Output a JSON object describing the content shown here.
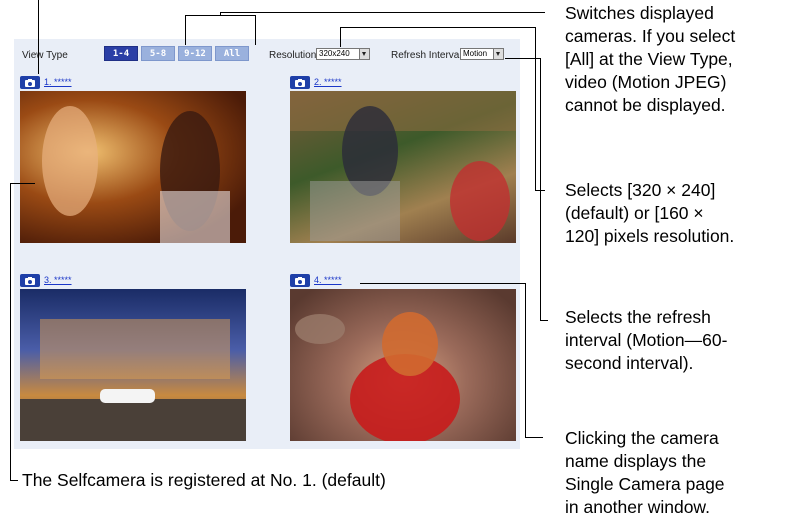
{
  "toolbar": {
    "view_type_label": "View Type",
    "view_type_buttons": [
      "1-4",
      "5-8",
      "9-12",
      "All"
    ],
    "resolution_label": "Resolution",
    "resolution_value": "320x240",
    "refresh_label": "Refresh Interval",
    "refresh_value": "Motion"
  },
  "cameras": [
    {
      "name": "1. *****"
    },
    {
      "name": "2. *****"
    },
    {
      "name": "3. *****"
    },
    {
      "name": "4. *****"
    }
  ],
  "annotations": {
    "view_type": [
      "Switches displayed",
      "cameras. If you select",
      "[All] at the View Type,",
      "video (Motion JPEG)",
      "cannot be displayed."
    ],
    "resolution": [
      "Selects [320 × 240]",
      "(default) or [160 ×",
      "120] pixels resolution."
    ],
    "refresh": [
      "Selects the refresh",
      "interval (Motion—60-",
      "second interval)."
    ],
    "camera_name": [
      "Clicking the camera",
      "name displays the",
      "Single Camera page",
      "in another window."
    ],
    "selfcamera": "The Selfcamera is registered at No. 1. (default)"
  },
  "colors": {
    "panel_bg": "#e9eef7",
    "active_button": "#2b3fa6",
    "inactive_button": "#9ab1dd",
    "link": "#1a36c8"
  }
}
